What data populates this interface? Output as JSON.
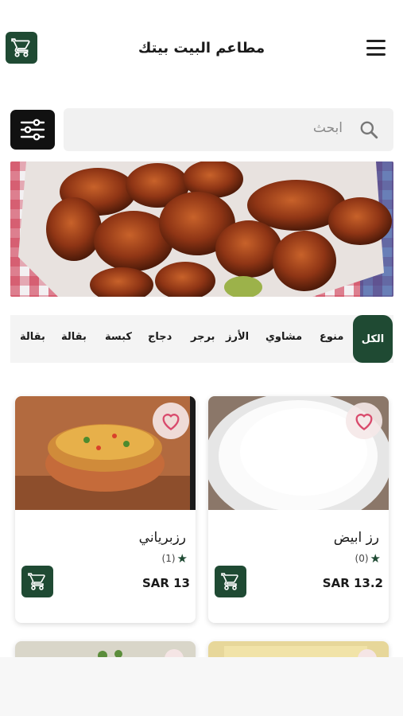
{
  "header": {
    "title": "مطاعم البيت بيتك",
    "cart_icon": "cart-icon",
    "menu_icon": "hamburger-menu-icon"
  },
  "search": {
    "placeholder": "ابحث",
    "filter_icon": "sliders-icon",
    "search_icon": "search-icon"
  },
  "banner": {
    "image": "fried-chicken-wings-photo"
  },
  "categories": [
    "الكل",
    "منوع",
    "مشاوي",
    "الأرز",
    "برجر",
    "دجاج",
    "كبسة",
    "بقالة",
    "بقالة"
  ],
  "products": [
    {
      "name": "رز ابيض",
      "rating_count": "(0)",
      "price": "SAR 13.2",
      "image": "white-rice-photo"
    },
    {
      "name": "رزبرياني",
      "rating_count": "(1)",
      "price": "SAR 13",
      "image": "biryani-rice-photo"
    }
  ],
  "colors": {
    "brand": "#1f4a33",
    "heart": "#d94a6c",
    "filter_bg": "#111111"
  }
}
